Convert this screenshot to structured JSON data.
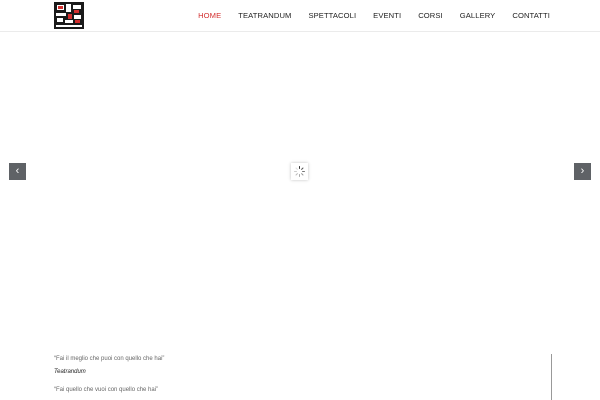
{
  "logo": {
    "alt_text": "Teatrandum",
    "icon": "logo-icon"
  },
  "nav": {
    "items": [
      {
        "label": "HOME",
        "active": true
      },
      {
        "label": "TEATRANDUM",
        "active": false
      },
      {
        "label": "SPETTACOLI",
        "active": false
      },
      {
        "label": "EVENTI",
        "active": false
      },
      {
        "label": "CORSI",
        "active": false
      },
      {
        "label": "GALLERY",
        "active": false
      },
      {
        "label": "CONTATTI",
        "active": false
      }
    ],
    "active_color": "#d32f2f"
  },
  "slider": {
    "prev_icon": "chevron-left-icon",
    "next_icon": "chevron-right-icon",
    "prev_glyph": "‹",
    "next_glyph": "›",
    "loading_icon": "spinner-icon"
  },
  "quotes": [
    {
      "text": "“Fai il meglio che puoi con quello che hai”",
      "author": "Teatrandum"
    },
    {
      "text": "“Fai quello che vuoi con quello che hai”"
    }
  ]
}
